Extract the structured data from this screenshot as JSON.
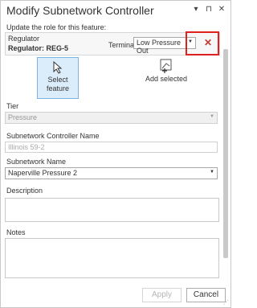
{
  "window": {
    "title": "Modify Subnetwork Controller"
  },
  "role": {
    "prompt": "Update the role for this feature:",
    "feature_type": "Regulator",
    "feature_id": "Regulator: REG-5",
    "terminal_label": "Terminal:",
    "terminal_value": "Low Pressure Out"
  },
  "tools": {
    "select_feature_label": "Select\nfeature",
    "add_selected_label": "Add selected"
  },
  "fields": {
    "tier_label": "Tier",
    "tier_value": "Pressure",
    "controller_name_label": "Subnetwork Controller Name",
    "controller_name_placeholder": "Illinois 59-2",
    "subnetwork_name_label": "Subnetwork Name",
    "subnetwork_name_value": "Naperville Pressure 2",
    "description_label": "Description",
    "notes_label": "Notes"
  },
  "buttons": {
    "apply": "Apply",
    "cancel": "Cancel"
  },
  "colors": {
    "highlight": "#e02020",
    "close": "#c0392b",
    "selected_tool_bg": "#dbecfa"
  }
}
